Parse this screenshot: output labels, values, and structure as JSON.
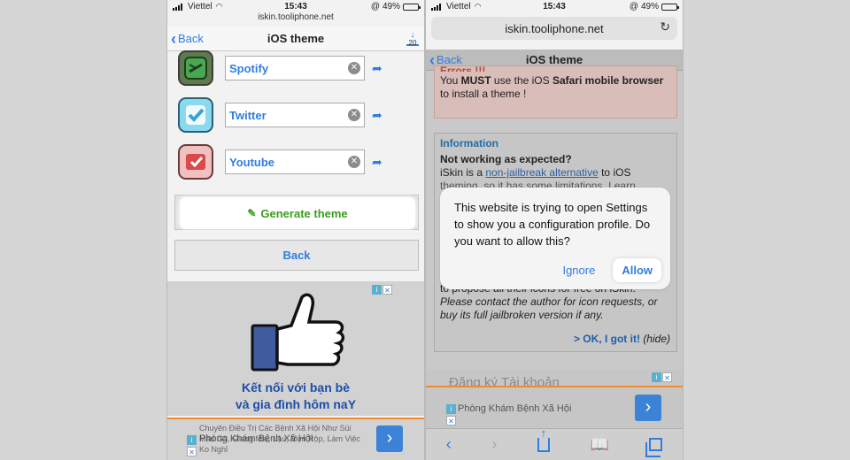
{
  "left": {
    "status": {
      "carrier": "Viettel",
      "time": "15:43",
      "battery_text": "49%",
      "battery_level": 0.49
    },
    "url": "iskin.tooliphone.net",
    "nav": {
      "back_label": "Back",
      "title": "iOS theme",
      "download_count": "20"
    },
    "apps": [
      {
        "name": "Spotify",
        "icon": "spotify-icon"
      },
      {
        "name": "Twitter",
        "icon": "twitter-icon"
      },
      {
        "name": "Youtube",
        "icon": "youtube-icon"
      }
    ],
    "generate_label": "Generate theme",
    "back_button_label": "Back",
    "ad": {
      "headline_1": "Kết nối với bạn bè",
      "headline_2": "và gia đình hôm naY",
      "bottom_text": "Chuyên Điều Trị Các Bệnh Xã Hội Như Sùi Mào Gà, Giang Mai, Lậu, Mụn Rộp, Làm Việc Ko Nghỉ",
      "bottom_overlay": "Phòng Khám Bệnh Xã Hội"
    }
  },
  "right": {
    "status": {
      "carrier": "Viettel",
      "time": "15:43",
      "battery_text": "49%",
      "battery_level": 0.49
    },
    "url": "iskin.tooliphone.net",
    "nav": {
      "back_label": "Back",
      "title": "iOS theme"
    },
    "error": {
      "title": "Errors !!!",
      "text_before": "You ",
      "must": "MUST",
      "text_mid": " use the iOS ",
      "safari": "Safari mobile browser",
      "text_after": " to install a theme !"
    },
    "info": {
      "title": "Information",
      "heading": "Not working as expected?",
      "line_1_before": "iSkin is a ",
      "line_1_link": "non-jailbreak alternative",
      "line_1_after": " to iOS",
      "line_2": "theming, so it has some limitations. Learn",
      "line_3": "to propose all their icons for free on iSkin.",
      "line_4": "Please contact the author for icon requests, or",
      "line_5": "buy its full jailbroken version if any."
    },
    "ok_label": "> OK, I got it!",
    "hide_label": "(hide)",
    "ad": {
      "headline": "Đăng ký Tài khoản",
      "bottom": "Phòng Khám Bệnh Xã Hội"
    },
    "dialog": {
      "message": "This website is trying to open Settings to show you a configuration profile. Do you want to allow this?",
      "ignore_label": "Ignore",
      "allow_label": "Allow"
    }
  },
  "colors": {
    "link_blue": "#2f7de1",
    "generate_green": "#3a9e1c",
    "ad_orange": "#f08a2a",
    "error_red": "#b84a3a"
  }
}
